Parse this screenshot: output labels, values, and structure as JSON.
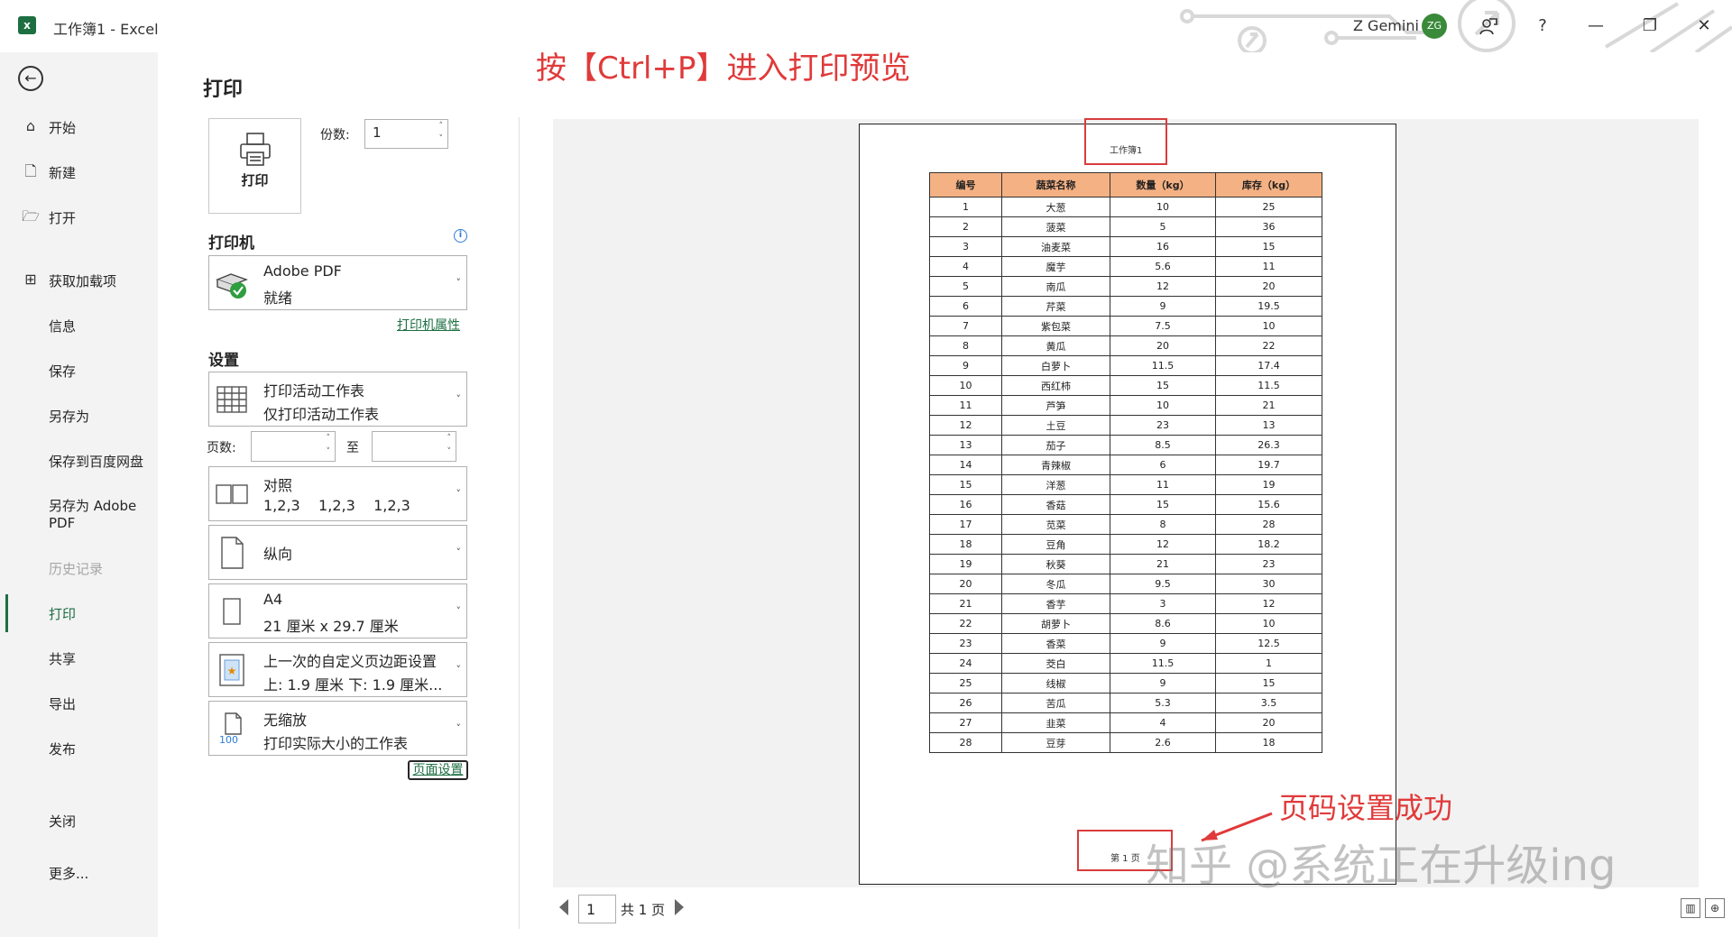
{
  "window": {
    "title": "工作簿1 - Excel",
    "user_name": "Z Gemini",
    "avatar_initials": "ZG",
    "accent": "#1d6f42"
  },
  "nav": {
    "items": [
      {
        "label": "开始",
        "icon": "home-icon"
      },
      {
        "label": "新建",
        "icon": "new-document-icon"
      },
      {
        "label": "打开",
        "icon": "folder-open-icon"
      },
      {
        "label": "获取加载项",
        "icon": "grid-apps-icon"
      },
      {
        "label": "信息"
      },
      {
        "label": "保存"
      },
      {
        "label": "另存为"
      },
      {
        "label": "保存到百度网盘"
      },
      {
        "label": "另存为 Adobe PDF"
      },
      {
        "label": "历史记录"
      },
      {
        "label": "打印"
      },
      {
        "label": "共享"
      },
      {
        "label": "导出"
      },
      {
        "label": "发布"
      },
      {
        "label": "关闭"
      },
      {
        "label": "更多..."
      }
    ],
    "active": "打印"
  },
  "print": {
    "title": "打印",
    "print_button_label": "打印",
    "copies_label": "份数:",
    "copies_value": "1",
    "printer_section": "打印机",
    "printer_name": "Adobe PDF",
    "printer_status": "就绪",
    "printer_props_link": "打印机属性",
    "settings_section": "设置",
    "scope_line1": "打印活动工作表",
    "scope_line2": "仅打印活动工作表",
    "pages_label": "页数:",
    "pages_to_label": "至",
    "collate_line1": "对照",
    "collate_line2": "1,2,3    1,2,3    1,2,3",
    "orientation": "纵向",
    "paper_line1": "A4",
    "paper_line2": "21 厘米 x 29.7 厘米",
    "margins_line1": "上一次的自定义页边距设置",
    "margins_line2": "上: 1.9 厘米 下: 1.9 厘米...",
    "scaling_line1": "无缩放",
    "scaling_line2": "打印实际大小的工作表",
    "scaling_icon_text": "100",
    "page_setup_link": "页面设置"
  },
  "preview": {
    "header_text": "工作簿1",
    "footer_text": "第 1 页",
    "page_number": "1",
    "page_total": "共 1 页",
    "table": {
      "headers": [
        "编号",
        "蔬菜名称",
        "数量（kg）",
        "库存（kg）"
      ],
      "rows": [
        [
          "1",
          "大葱",
          "10",
          "25"
        ],
        [
          "2",
          "菠菜",
          "5",
          "36"
        ],
        [
          "3",
          "油麦菜",
          "16",
          "15"
        ],
        [
          "4",
          "魔芋",
          "5.6",
          "11"
        ],
        [
          "5",
          "南瓜",
          "12",
          "20"
        ],
        [
          "6",
          "芹菜",
          "9",
          "19.5"
        ],
        [
          "7",
          "紫包菜",
          "7.5",
          "10"
        ],
        [
          "8",
          "黄瓜",
          "20",
          "22"
        ],
        [
          "9",
          "白萝卜",
          "11.5",
          "17.4"
        ],
        [
          "10",
          "西红柿",
          "15",
          "11.5"
        ],
        [
          "11",
          "芦笋",
          "10",
          "21"
        ],
        [
          "12",
          "土豆",
          "23",
          "13"
        ],
        [
          "13",
          "茄子",
          "8.5",
          "26.3"
        ],
        [
          "14",
          "青辣椒",
          "6",
          "19.7"
        ],
        [
          "15",
          "洋葱",
          "11",
          "19"
        ],
        [
          "16",
          "香菇",
          "15",
          "15.6"
        ],
        [
          "17",
          "苋菜",
          "8",
          "28"
        ],
        [
          "18",
          "豆角",
          "12",
          "18.2"
        ],
        [
          "19",
          "秋葵",
          "21",
          "23"
        ],
        [
          "20",
          "冬瓜",
          "9.5",
          "30"
        ],
        [
          "21",
          "香芋",
          "3",
          "12"
        ],
        [
          "22",
          "胡萝卜",
          "8.6",
          "10"
        ],
        [
          "23",
          "香菜",
          "9",
          "12.5"
        ],
        [
          "24",
          "茭白",
          "11.5",
          "1"
        ],
        [
          "25",
          "线椒",
          "9",
          "15"
        ],
        [
          "26",
          "苦瓜",
          "5.3",
          "3.5"
        ],
        [
          "27",
          "韭菜",
          "4",
          "20"
        ],
        [
          "28",
          "豆芽",
          "2.6",
          "18"
        ]
      ]
    }
  },
  "annotations": {
    "top": "按【Ctrl+P】进入打印预览",
    "bottom": "页码设置成功",
    "watermark": "知乎 @系统正在升级ing",
    "color": "#e03a3a"
  }
}
